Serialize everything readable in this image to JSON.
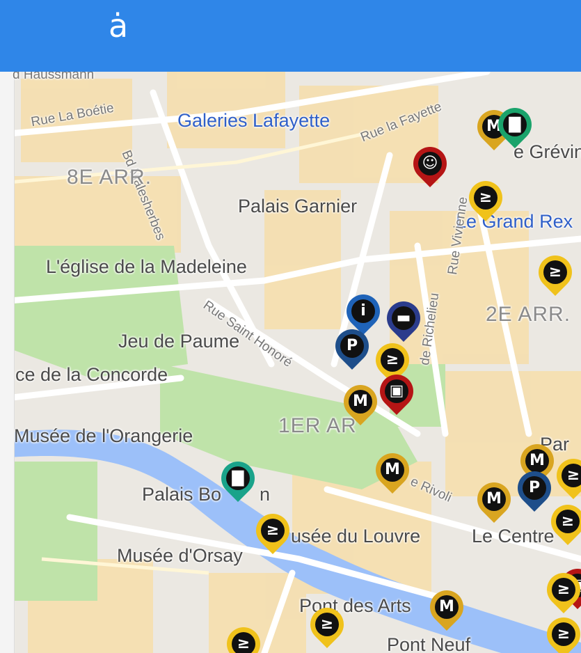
{
  "header": {
    "logo_glyph": "ȧ",
    "bg_color": "#2f86e8"
  },
  "map": {
    "labels": {
      "haussmann": "d Haussmann",
      "rue_la_boetie": "Rue La Boétie",
      "bd_malesherbes": "Bd Malesherbes",
      "galeries_lafayette": "Galeries Lafayette",
      "rue_la_fayette": "Rue la Fayette",
      "arr8": "8E ARR.",
      "palais_garnier": "Palais Garnier",
      "grevin": "e Grévin",
      "le_grand_rex": "Le Grand Rex",
      "madeleine": "L'église de la Madeleine",
      "rue_saint_honore": "Rue Saint Honoré",
      "rue_richelieu": "de Richelieu",
      "rue_vivienne": "Rue Vivienne",
      "arr2": "2E ARR.",
      "jeu_de_paume": "Jeu de Paume",
      "concorde": "ce de la Concorde",
      "orangerie": "Musée de l'Orangerie",
      "arr1": "1ER AR",
      "palais_bourbon": "Palais Bo",
      "palais_bourbon_end": "n",
      "rivoli": "e Rivoli",
      "louvre": "usée du Louvre",
      "orsay": "Musée d'Orsay",
      "le_centre": "Le Centre",
      "pont_des_arts": "Pont des Arts",
      "pont_neuf": "Pont Neuf",
      "par": "Par"
    },
    "pins": [
      {
        "id": "museum-pin-1",
        "kind": "museum",
        "color": "#d9a520",
        "glyph": "M"
      },
      {
        "id": "bus-pin-1",
        "kind": "bus",
        "color": "#1aa36b",
        "glyph": "▇"
      },
      {
        "id": "theatre-pin-1",
        "kind": "theatre",
        "color": "#b51515",
        "glyph": "☺"
      },
      {
        "id": "metro-pin-1",
        "kind": "metro",
        "color": "#f0c21b",
        "glyph": "≥"
      },
      {
        "id": "metro-pin-2",
        "kind": "metro",
        "color": "#f0c21b",
        "glyph": "≥"
      },
      {
        "id": "info-pin",
        "kind": "info",
        "color": "#1f63b8",
        "glyph": "i"
      },
      {
        "id": "hotel-pin",
        "kind": "hotel",
        "color": "#2b3c8c",
        "glyph": "▬"
      },
      {
        "id": "parking-pin-1",
        "kind": "parking",
        "color": "#1e4e8a",
        "glyph": "P"
      },
      {
        "id": "metro-pin-3",
        "kind": "metro",
        "color": "#f0c21b",
        "glyph": "≥"
      },
      {
        "id": "cinema-pin-1",
        "kind": "cinema",
        "color": "#b51515",
        "glyph": "▣"
      },
      {
        "id": "museum-pin-2",
        "kind": "museum",
        "color": "#d9a520",
        "glyph": "M"
      },
      {
        "id": "museum-pin-3",
        "kind": "museum",
        "color": "#d9a520",
        "glyph": "M"
      },
      {
        "id": "bus-pin-2",
        "kind": "bus",
        "color": "#1aa38a",
        "glyph": "▇"
      },
      {
        "id": "metro-pin-4",
        "kind": "metro",
        "color": "#f0c21b",
        "glyph": "≥"
      },
      {
        "id": "museum-pin-4",
        "kind": "museum",
        "color": "#d9a520",
        "glyph": "M"
      },
      {
        "id": "parking-pin-2",
        "kind": "parking",
        "color": "#1e4e8a",
        "glyph": "P"
      },
      {
        "id": "museum-pin-5",
        "kind": "museum",
        "color": "#d9a520",
        "glyph": "M"
      },
      {
        "id": "metro-pin-5",
        "kind": "metro",
        "color": "#f0c21b",
        "glyph": "≥"
      },
      {
        "id": "metro-pin-6",
        "kind": "metro",
        "color": "#f0c21b",
        "glyph": "≥"
      },
      {
        "id": "museum-pin-6",
        "kind": "museum",
        "color": "#d9a520",
        "glyph": "M"
      },
      {
        "id": "metro-pin-7",
        "kind": "metro",
        "color": "#f0c21b",
        "glyph": "≥"
      },
      {
        "id": "metro-pin-8",
        "kind": "metro",
        "color": "#f0c21b",
        "glyph": "≥"
      },
      {
        "id": "metro-pin-9",
        "kind": "metro",
        "color": "#f0c21b",
        "glyph": "≥"
      },
      {
        "id": "cinema-pin-2",
        "kind": "cinema",
        "color": "#b51515",
        "glyph": "▣"
      },
      {
        "id": "metro-pin-10",
        "kind": "metro",
        "color": "#f0c21b",
        "glyph": "≥"
      }
    ]
  }
}
